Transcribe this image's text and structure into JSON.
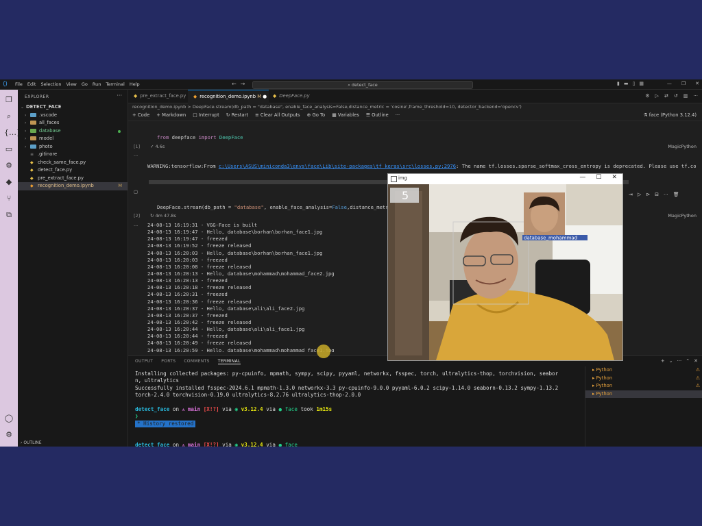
{
  "menu": [
    "File",
    "Edit",
    "Selection",
    "View",
    "Go",
    "Run",
    "Terminal",
    "Help"
  ],
  "search": {
    "text": "detect_face"
  },
  "explorer": {
    "header": "EXPLORER",
    "root": "DETECT_FACE",
    "items": [
      {
        "label": ".vscode",
        "kind": "folder"
      },
      {
        "label": "all_faces",
        "kind": "folder"
      },
      {
        "label": "database",
        "kind": "folder"
      },
      {
        "label": "model",
        "kind": "folder"
      },
      {
        "label": "photo",
        "kind": "folder"
      },
      {
        "label": ".gitinore",
        "kind": "file"
      },
      {
        "label": "check_same_face.py",
        "kind": "file"
      },
      {
        "label": "detect_face.py",
        "kind": "file"
      },
      {
        "label": "pre_extract_face.py",
        "kind": "file"
      },
      {
        "label": "recognition_demo.ipynb",
        "kind": "file",
        "badge": "M"
      }
    ],
    "outline": "OUTLINE"
  },
  "tabs": [
    {
      "label": "pre_extract_face.py"
    },
    {
      "label": "recognition_demo.ipynb",
      "modified": "M"
    },
    {
      "label": "DeepFace.py"
    }
  ],
  "breadcrumb": "recognition_demo.ipynb > DeepFace.stream(db_path = \"database\", enable_face_analysis=False,distance_metric = 'cosine',frame_threshold=10, detector_backend='opencv')",
  "toolbar": {
    "code": "+ Code",
    "markdown": "+ Markdown",
    "interrupt": "Interrupt",
    "restart": "Restart",
    "clear": "Clear All Outputs",
    "goto": "Go To",
    "variables": "Variables",
    "outline": "Outline",
    "more": "···",
    "kernel": "face (Python 3.12.4)"
  },
  "cell1": {
    "code_kw": "from",
    "code_mod": "deepface",
    "code_kw2": "import",
    "code_cls": "DeepFace",
    "exec": "[1]",
    "time": "4.6s",
    "magic": "MagicPython"
  },
  "warning": {
    "prefix": "WARNING:tensorflow:From ",
    "link": "c:\\Users\\ASUS\\miniconda3\\envs\\face\\Lib\\site-packages\\tf_keras\\src\\losses.py:2976",
    "suffix": ": The name tf.losses.sparse_softmax_cross_entropy is deprecated. Please use tf.compat.v1.lo"
  },
  "cell2": {
    "code_fn": "DeepFace.stream(db_path = ",
    "code_str": "\"database\"",
    "code_mid": ", enable_face_analysis=",
    "code_bool": "False",
    "code_end": ",distance_metric",
    "exec": "[2]",
    "time": "4m 47.8s",
    "magic": "MagicPython"
  },
  "log": [
    "24-08-13 16:19:31 - VGG-Face is built",
    "24-08-13 16:19:47 - Hello, database\\borhan\\borhan_face1.jpg",
    "24-08-13 16:19:47 - freezed",
    "24-08-13 16:19:52 - freeze released",
    "24-08-13 16:20:03 - Hello, database\\borhan\\borhan_face1.jpg",
    "24-08-13 16:20:03 - freezed",
    "24-08-13 16:20:08 - freeze released",
    "24-08-13 16:20:13 - Hello, database\\mohammad\\mohammad_face2.jpg",
    "24-08-13 16:20:13 - freezed",
    "24-08-13 16:20:18 - freeze released",
    "24-08-13 16:20:31 - freezed",
    "24-08-13 16:20:36 - freeze released",
    "24-08-13 16:20:37 - Hello, database\\ali\\ali_face2.jpg",
    "24-08-13 16:20:37 - freezed",
    "24-08-13 16:20:42 - freeze released",
    "24-08-13 16:20:44 - Hello, database\\ali\\ali_face1.jpg",
    "24-08-13 16:20:44 - freezed",
    "24-08-13 16:20:49 - freeze released",
    "24-08-13 16:20:59 - Hello, database\\mohammad\\mohammad_face1.jpg"
  ],
  "panel": {
    "tabs": [
      "OUTPUT",
      "PORTS",
      "COMMENTS",
      "TERMINAL"
    ],
    "install_line1": "Installing collected packages: py-cpuinfo, mpmath, sympy, scipy, pyyaml, networkx, fsspec, torch, ultralytics-thop, torchvision, seabor",
    "install_line2": "n, ultralytics",
    "success_line1": "Successfully installed fsspec-2024.6.1 mpmath-1.3.0 networkx-3.3 py-cpuinfo-9.0.0 pyyaml-6.0.2 scipy-1.14.0 seaborn-0.13.2 sympy-1.13.2",
    "success_line2": " torch-2.4.0 torchvision-0.19.0 ultralytics-8.2.76 ultralytics-thop-2.0.0",
    "prompt_dir": "detect_face",
    "prompt_on": " on ",
    "prompt_branch": "ᴧ main",
    "prompt_status": "[X!?]",
    "prompt_via": " via ",
    "prompt_py": "v3.12.4",
    "prompt_env": "face",
    "prompt_took": " took ",
    "prompt_dur": "1m15s",
    "history": "History restored",
    "arrow": "❯",
    "term_items": [
      "Python",
      "Python",
      "Python",
      "Python"
    ]
  },
  "imgwin": {
    "title": "img",
    "frame_count": "5",
    "match_label": "database_mohammad"
  }
}
